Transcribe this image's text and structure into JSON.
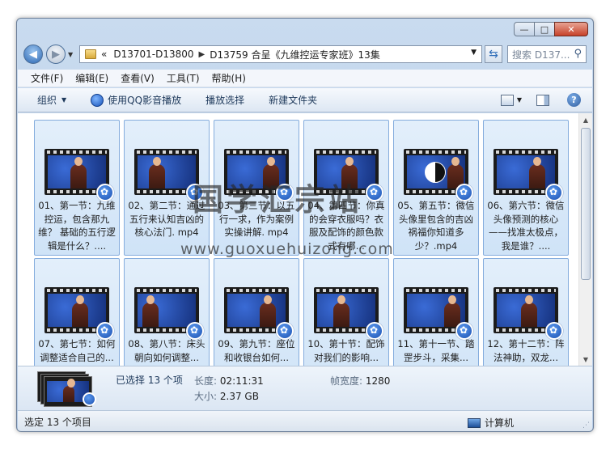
{
  "window": {
    "caption": {
      "minimize": "—",
      "maximize": "□",
      "close": "✕"
    }
  },
  "address": {
    "back": "◀",
    "forward": "▶",
    "overflow": "«",
    "crumbs": [
      "D13701-D13800",
      "D13759 合呈《九维控运专家班》13集"
    ],
    "search_placeholder": "搜索 D137...",
    "search_icon": "search-icon"
  },
  "menu": [
    "文件(F)",
    "编辑(E)",
    "查看(V)",
    "工具(T)",
    "帮助(H)"
  ],
  "toolbar": {
    "organize": "组织",
    "play_qq": "使用QQ影音播放",
    "play_selection": "播放选择",
    "new_folder": "新建文件夹"
  },
  "files": [
    {
      "name": "01、第一节：九维控运，包含那九维？ 基础的五行逻辑是什么？...."
    },
    {
      "name": "02、第二节：通过五行来认知吉凶的核心法门. mp4"
    },
    {
      "name": "03、第三节：以五行一求，作为案例实操讲解. mp4"
    },
    {
      "name": "04、第四节：你真的会穿衣服吗？衣服及配饰的颜色款式有哪..."
    },
    {
      "name": "05、第五节：微信头像里包含的吉凶祸福你知道多少？.mp4"
    },
    {
      "name": "06、第六节：微信头像预测的核心——找准太极点，我是谁？...."
    },
    {
      "name": "07、第七节：如何调整适合自己的..."
    },
    {
      "name": "08、第八节：床头朝向如何调整..."
    },
    {
      "name": "09、第九节：座位和收银台如何..."
    },
    {
      "name": "10、第十节：配饰对我们的影响..."
    },
    {
      "name": "11、第十一节、踏罡步斗，采集..."
    },
    {
      "name": "12、第十二节：阵法神助，双龙..."
    }
  ],
  "watermark": {
    "cn": "国学汇宗站",
    "url": "www.guoxuehuizong.com"
  },
  "details": {
    "selected": "已选择 13 个项",
    "length_label": "长度:",
    "length_value": "02:11:31",
    "size_label": "大小:",
    "size_value": "2.37 GB",
    "width_label": "帧宽度:",
    "width_value": "1280"
  },
  "status": {
    "left": "选定 13 个项目",
    "right": "计算机"
  }
}
